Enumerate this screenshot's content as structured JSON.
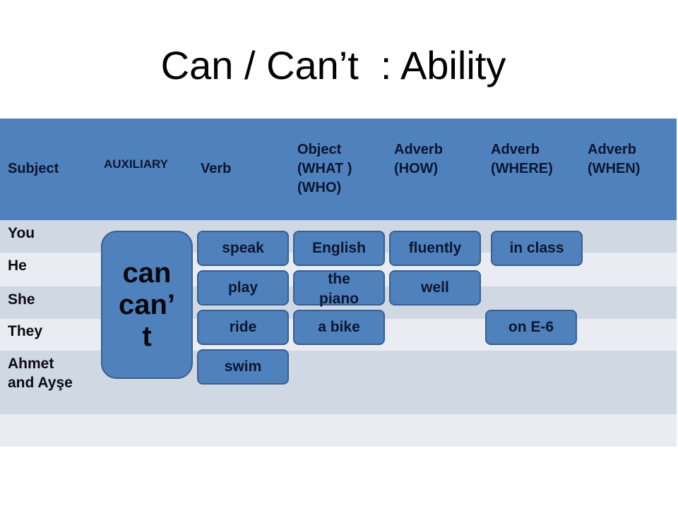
{
  "title": "Can / Can’t  : Ability",
  "colors": {
    "header_bg": "#4f81bd",
    "row_dark": "#d0d8e4",
    "row_light": "#e9edf3",
    "box_fill": "#4f81bd",
    "box_border": "#3a5f8c"
  },
  "headers": {
    "subject": "Subject",
    "auxiliary": "AUXILIARY",
    "verb": "Verb",
    "object": "Object\n(WHAT )\n(WHO)",
    "adverb_how": "Adverb\n(HOW)",
    "adverb_where": "Adverb\n(WHERE)",
    "adverb_when": "Adverb\n(WHEN)"
  },
  "subjects": [
    "You",
    "He",
    "She",
    "They",
    "Ahmet\nand Ayşe"
  ],
  "auxiliary": "can\ncan’\nt",
  "verbs": [
    "speak",
    "play",
    "ride",
    "swim"
  ],
  "objects": [
    "English",
    "the\npiano",
    "a bike"
  ],
  "adverbs_how": [
    "fluently",
    "well"
  ],
  "adverbs_where": [
    "in class",
    "on E-6"
  ],
  "adverbs_when": []
}
